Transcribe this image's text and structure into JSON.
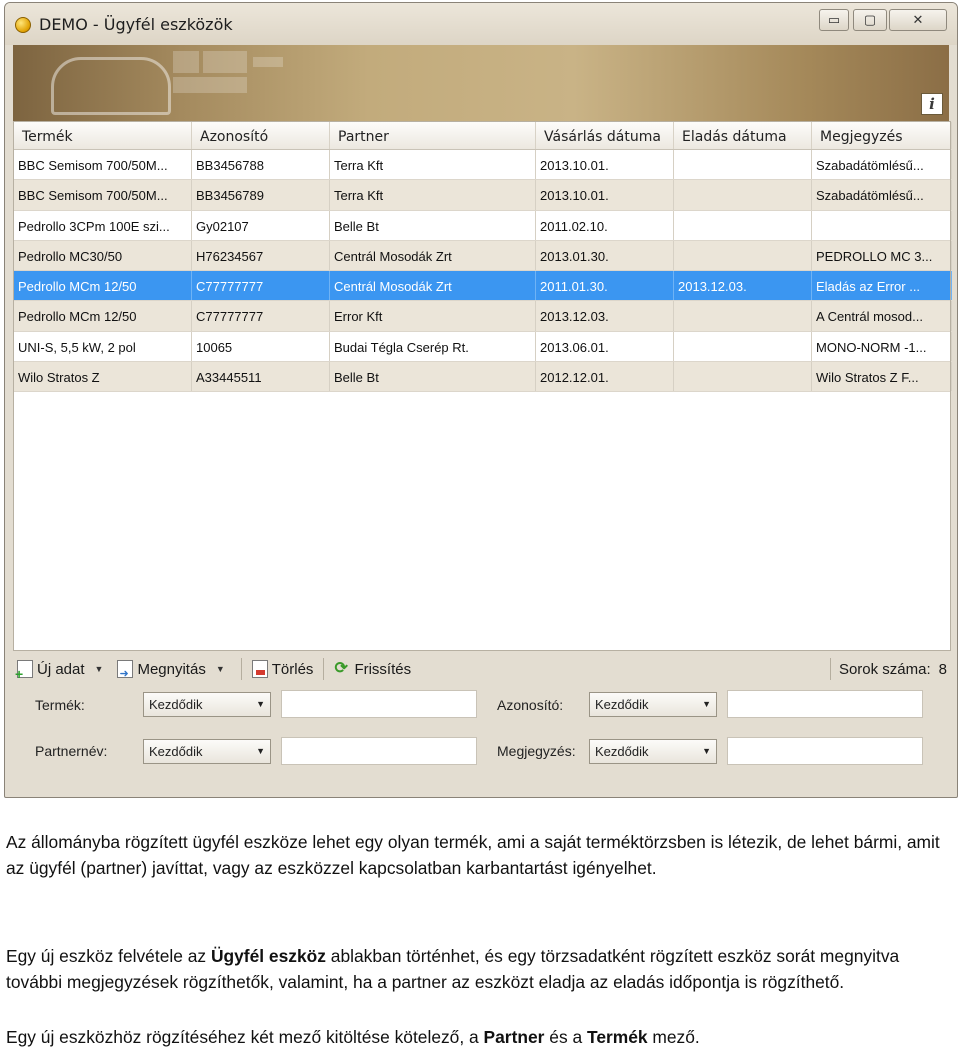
{
  "window": {
    "title": "DEMO - Ügyfél eszközök",
    "info_glyph": "i",
    "buttons": {
      "min": "▭",
      "max": "▢",
      "close": "✕"
    }
  },
  "grid": {
    "columns": [
      "Termék",
      "Azonosító",
      "Partner",
      "Vásárlás dátuma",
      "Eladás dátuma",
      "Megjegyzés"
    ],
    "rows": [
      [
        "BBC Semisom 700/50M...",
        "BB3456788",
        "Terra Kft",
        "2013.10.01.",
        "",
        "Szabadátömlésű..."
      ],
      [
        "BBC Semisom 700/50M...",
        "BB3456789",
        "Terra Kft",
        "2013.10.01.",
        "",
        "Szabadátömlésű..."
      ],
      [
        "Pedrollo 3CPm 100E szi...",
        "Gy02107",
        "Belle Bt",
        "2011.02.10.",
        "",
        ""
      ],
      [
        "Pedrollo MC30/50",
        "H76234567",
        "Centrál Mosodák Zrt",
        "2013.01.30.",
        "",
        "PEDROLLO MC 3..."
      ],
      [
        "Pedrollo MCm 12/50",
        "C77777777",
        "Centrál Mosodák Zrt",
        "2011.01.30.",
        "2013.12.03.",
        "Eladás az Error ..."
      ],
      [
        "Pedrollo MCm 12/50",
        "C77777777",
        "Error Kft",
        "2013.12.03.",
        "",
        "A Centrál mosod..."
      ],
      [
        "UNI-S, 5,5 kW, 2 pol",
        "10065",
        "Budai Tégla Cserép Rt.",
        "2013.06.01.",
        "",
        "MONO-NORM -1..."
      ],
      [
        "Wilo Stratos Z",
        "A33445511",
        "Belle Bt",
        "2012.12.01.",
        "",
        "Wilo Stratos Z F..."
      ]
    ],
    "selected_row_index": 4
  },
  "toolbar": {
    "new_label": "Új adat",
    "open_label": "Megnyitás",
    "delete_label": "Törlés",
    "refresh_label": "Frissítés",
    "count_label": "Sorok száma:",
    "count_value": "8"
  },
  "filters": {
    "termek_label": "Termék:",
    "termek_mode": "Kezdődik",
    "partner_label": "Partnernév:",
    "partner_mode": "Kezdődik",
    "azonosito_label": "Azonosító:",
    "azonosito_mode": "Kezdődik",
    "megjegyzes_label": "Megjegyzés:",
    "megjegyzes_mode": "Kezdődik"
  },
  "doc": {
    "p1": "Az állományba rögzített ügyfél eszköze lehet egy olyan termék, ami a saját terméktörzsben is létezik, de lehet bármi, amit az ügyfél (partner) javíttat, vagy az eszközzel kapcsolatban karbantartást igényelhet.",
    "p2_a": "Egy új eszköz felvétele az ",
    "p2_b": "Ügyfél eszköz",
    "p2_c": " ablakban történhet, és egy törzsadatként rögzített eszköz sorát megnyitva további megjegyzések rögzíthetők, valamint, ha a partner az eszközt eladja az eladás időpontja is rögzíthető.",
    "p3_a": "Egy új eszközhöz rögzítéséhez két mező kitöltése kötelező, a ",
    "p3_b": "Partner",
    "p3_c": " és a ",
    "p3_d": "Termék",
    "p3_e": " mező."
  },
  "colors": {
    "selected_row": "#3b96f1",
    "alt_row": "#ebe5d9",
    "window_bg": "#e3ddd1"
  }
}
